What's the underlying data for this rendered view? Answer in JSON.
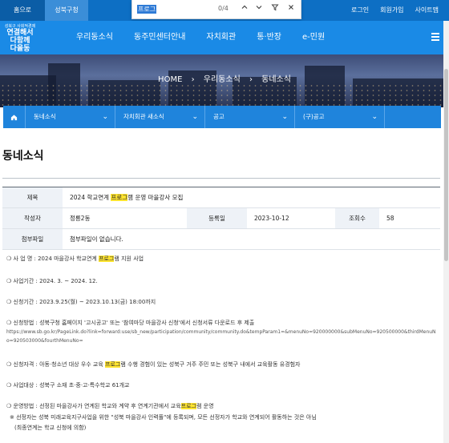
{
  "topbar": {
    "home_tab": "홈으로",
    "gu_tab": "성북구청",
    "links": [
      "로그인",
      "회원가입",
      "사이트맵"
    ]
  },
  "findbar": {
    "query": "프로그",
    "count": "0/4",
    "prev_icon": "chevron-up-icon",
    "next_icon": "chevron-down-icon",
    "filter_icon": "filter-icon",
    "close_icon": "close-icon"
  },
  "header": {
    "logo_small": "성북구 사회적경제",
    "logo_line1": "연결해서",
    "logo_line2": "다함께",
    "logo_line3": "다올동",
    "gnb": [
      "우리동소식",
      "동주민센터안내",
      "자치회관",
      "통·반장",
      "e-민원"
    ]
  },
  "hero": {
    "breadcrumb": [
      "HOME",
      "우리동소식",
      "동네소식"
    ]
  },
  "subnav": {
    "items": [
      "동네소식",
      "자치회관 새소식",
      "공고",
      "(구)공고"
    ]
  },
  "page": {
    "title": "동네소식"
  },
  "info": {
    "title_label": "제목",
    "title_pre": "2024 학교연계 ",
    "title_hl": "프로그",
    "title_post": "램 운영 마을강사 모집",
    "author_label": "작성자",
    "author": "정릉2동",
    "date_label": "등록일",
    "date": "2023-10-12",
    "views_label": "조회수",
    "views": "58",
    "attach_label": "첨부파일",
    "attach": "첨부파일이 없습니다."
  },
  "body": {
    "l1_pre": "❍ 사 업 명 : 2024 마을강사 학교연계 ",
    "l1_hl": "프로그",
    "l1_post": "램 지원 사업",
    "l2": "❍ 사업기간 : 2024. 3. ~ 2024. 12.",
    "l3": "❍ 신청기간 : 2023.9.25(월) ~ 2023.10.13(금) 18:00까지",
    "l4": "❍ 신청방법 : 성북구청 홈페이지 '고시공고' 또는 '참여마당 마을강사 신청'에서 신청서류 다운로드 후 제출",
    "l5": "https://www.sb.go.kr/PageLink.do?link=forward:use/sb_new/participation/community/community.do&tempParam1=&menuNo=920000000&subMenuNo=920500000&thirdMenuNo=920503000&fourthMenuNo=",
    "l6_pre": "❍ 신청자격 : 아동·청소년 대상 우수 교육 ",
    "l6_hl": "프로그",
    "l6_post": "램 수행 경험이 있는 성북구 거주 주민  또는 성북구 내에서 교육활동 유경험자",
    "l7": "❍ 사업대상 : 성북구 소재 초·중·고·특수학교 61개교",
    "l8_pre": "❍ 운영방법 : 선정된 마을강사가 연계된 학교와 계약 후 연계기관에서 교육",
    "l8_hl": "프로그",
    "l8_post": "램 운영",
    "l9": "※ 선정자는 성북 미래교육지구사업을 위한 \"성북 마을강사 인력풀\"에 등록되며, 모든 선정자가 학교와 연계되어 활동하는 것은 아님",
    "l10": "(최종연계는 학교 신청에 의함)"
  }
}
